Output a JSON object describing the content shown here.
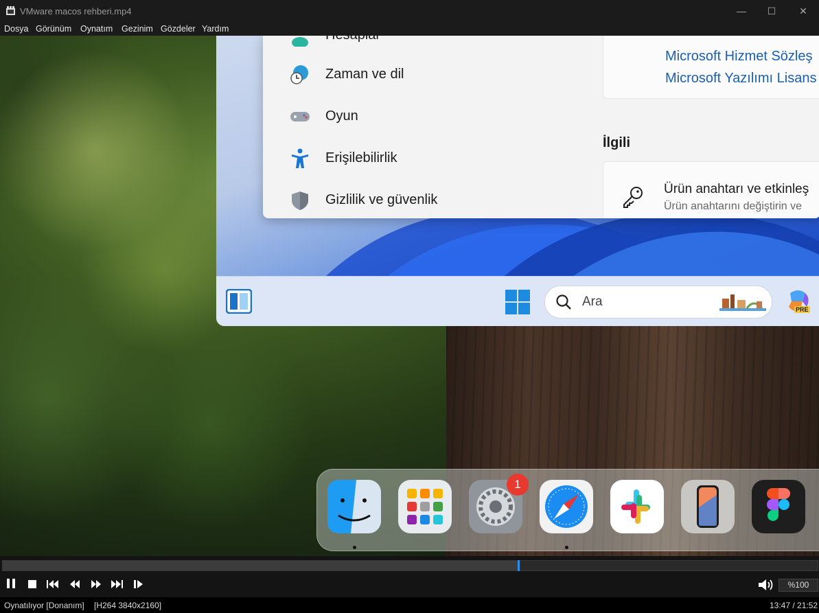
{
  "window": {
    "title": "VMware macos rehberi.mp4",
    "minimize": "—",
    "maximize": "☐",
    "close": "✕"
  },
  "menu": [
    "Dosya",
    "Görünüm",
    "Oynatım",
    "Gezinim",
    "Gözdeler",
    "Yardım"
  ],
  "settings": {
    "nav": [
      {
        "label": "Hesaplar",
        "icon": "accounts-icon"
      },
      {
        "label": "Zaman ve dil",
        "icon": "time-language-icon"
      },
      {
        "label": "Oyun",
        "icon": "gamepad-icon"
      },
      {
        "label": "Erişilebilirlik",
        "icon": "accessibility-icon"
      },
      {
        "label": "Gizlilik ve güvenlik",
        "icon": "shield-icon"
      }
    ],
    "links": [
      "Microsoft Hizmet Sözleş",
      "Microsoft Yazılımı Lisans"
    ],
    "related_heading": "İlgili",
    "product_key": {
      "title": "Ürün anahtarı ve etkinleş",
      "subtitle": "Ürün anahtarını değiştirin ve"
    }
  },
  "taskbar": {
    "search_placeholder": "Ara",
    "copilot_badge": "PRE"
  },
  "dock": {
    "apps": [
      "Finder",
      "Launchpad",
      "System Settings",
      "Safari",
      "Slack",
      "iPhone Mirroring",
      "Figma"
    ],
    "settings_badge": "1"
  },
  "player": {
    "progress": 0.633,
    "volume_label": "%100",
    "status_left": "Oynatılıyor [Donanım]",
    "codec": "[H264 3840x2160]",
    "time": "13:47 / 21:52"
  },
  "colors": {
    "link": "#1a5fb4",
    "accent": "#2f8ee6",
    "badge": "#e8392f"
  }
}
